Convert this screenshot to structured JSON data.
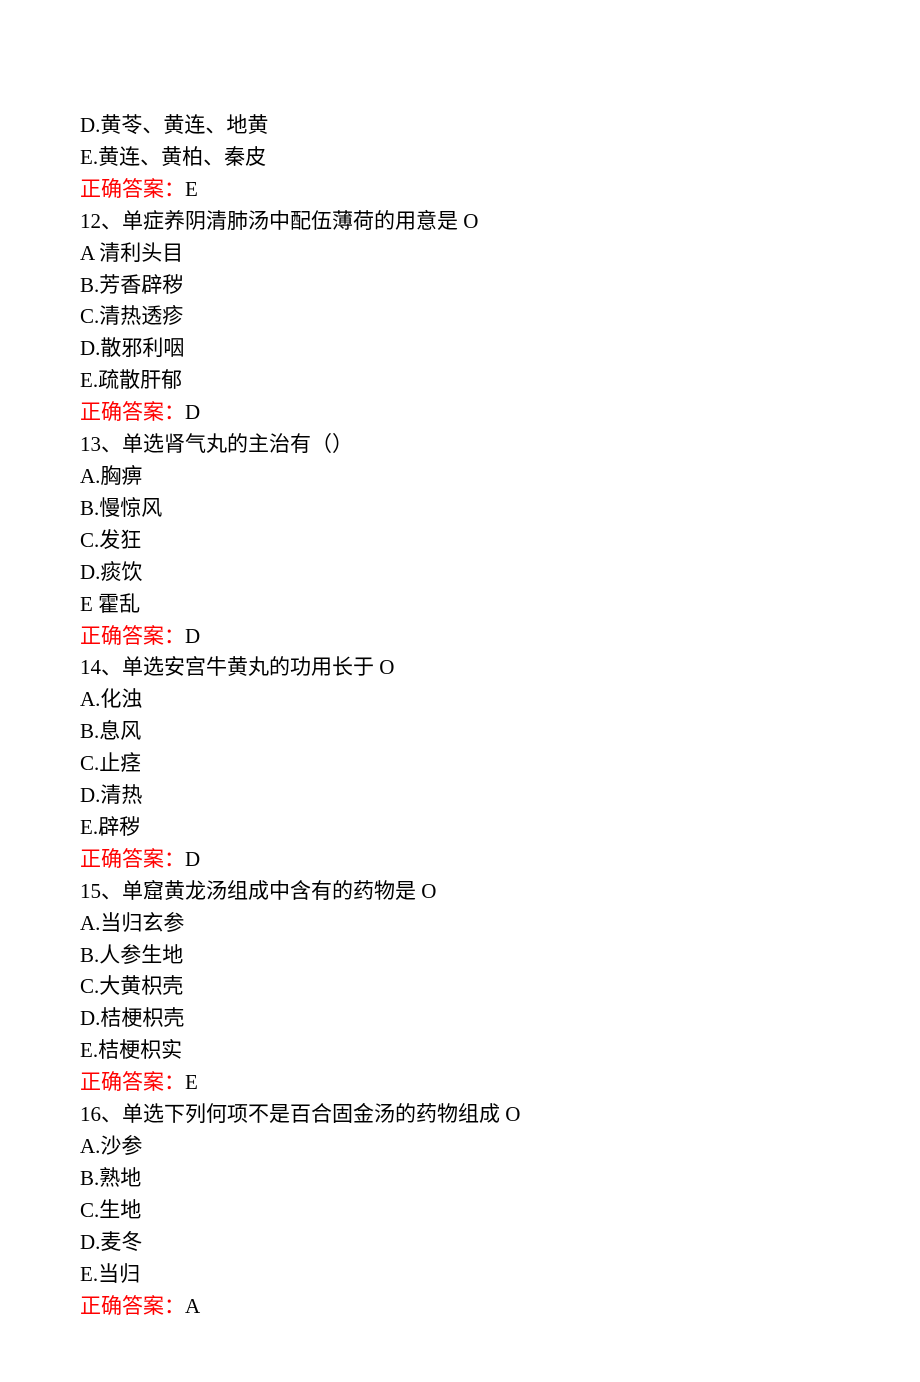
{
  "q11_tail": {
    "optD": "D.黄苓、黄连、地黄",
    "optE": "E.黄连、黄柏、秦皮",
    "answerLabel": "正确答案：",
    "answer": "E"
  },
  "q12": {
    "stem": "12、单症养阴清肺汤中配伍薄荷的用意是 O",
    "optA": "A 清利头目",
    "optB": "B.芳香辟秽",
    "optC": "C.清热透疹",
    "optD": "D.散邪利咽",
    "optE": "E.疏散肝郁",
    "answerLabel": "正确答案：",
    "answer": "D"
  },
  "q13": {
    "stem": "13、单选肾气丸的主治有（）",
    "optA": "A.胸痹",
    "optB": "B.慢惊风",
    "optC": "C.发狂",
    "optD": "D.痰饮",
    "optE": "E 霍乱",
    "answerLabel": "正确答案：",
    "answer": "D"
  },
  "q14": {
    "stem": "14、单选安宫牛黄丸的功用长于 O",
    "optA": "A.化浊",
    "optB": "B.息风",
    "optC": "C.止痉",
    "optD": "D.清热",
    "optE": "E.辟秽",
    "answerLabel": "正确答案：",
    "answer": "D"
  },
  "q15": {
    "stem": "15、单窟黄龙汤组成中含有的药物是 O",
    "optA": "A.当归玄参",
    "optB": "B.人参生地",
    "optC": "C.大黄枳壳",
    "optD": "D.桔梗枳壳",
    "optE": "E.桔梗枳实",
    "answerLabel": "正确答案：",
    "answer": "E"
  },
  "q16": {
    "stem": "16、单选下列何项不是百合固金汤的药物组成 O",
    "optA": "A.沙参",
    "optB": "B.熟地",
    "optC": "C.生地",
    "optD": "D.麦冬",
    "optE": "E.当归",
    "answerLabel": "正确答案：",
    "answer": "A"
  }
}
